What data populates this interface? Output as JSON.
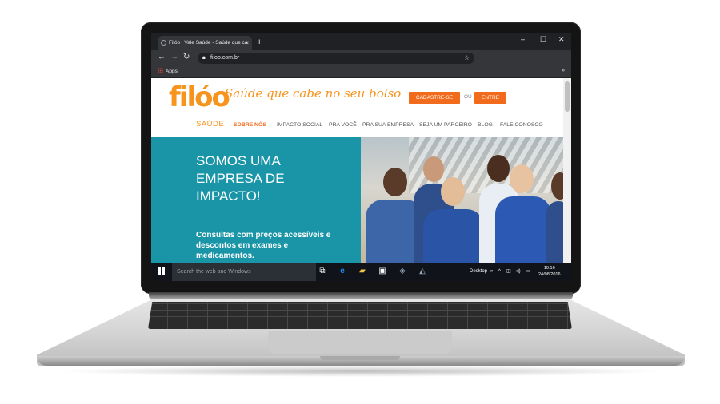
{
  "browser": {
    "tab_title": "Filóo | Vale Saúde - Saúde que ca",
    "tab_close": "×",
    "new_tab": "+",
    "url": "filoo.com.br",
    "bookmark_apps": "Apps",
    "bookmark_more": "»",
    "window_controls": [
      "–",
      "☐",
      "✕"
    ],
    "nav_icons": [
      "back-arrow",
      "forward-arrow",
      "reload"
    ]
  },
  "site": {
    "logo_text": "filóo",
    "logo_sub": "SAÚDE",
    "tagline": "Saúde que cabe no seu bolso",
    "signup_button": "CADASTRE-SE",
    "or_label": "OU",
    "login_button": "ENTRE",
    "menu": [
      "SOBRE NÓS",
      "IMPACTO SOCIAL",
      "PRA VOCÊ",
      "PRA SUA EMPRESA",
      "SEJA UM PARCEIRO",
      "BLOG",
      "FALE CONOSCO"
    ],
    "hero_title": [
      "SOMOS UMA",
      "EMPRESA DE",
      "IMPACTO!"
    ],
    "hero_text": "Consultas com preços acessíveis e descontos em exames e medicamentos.",
    "colors": {
      "brand_orange": "#f26a1b",
      "hero_teal": "#1a95a7"
    }
  },
  "taskbar": {
    "search_placeholder": "Search the web and Windows",
    "desktop_label": "Desktop",
    "time": "10:16",
    "date": "24/08/2016"
  }
}
